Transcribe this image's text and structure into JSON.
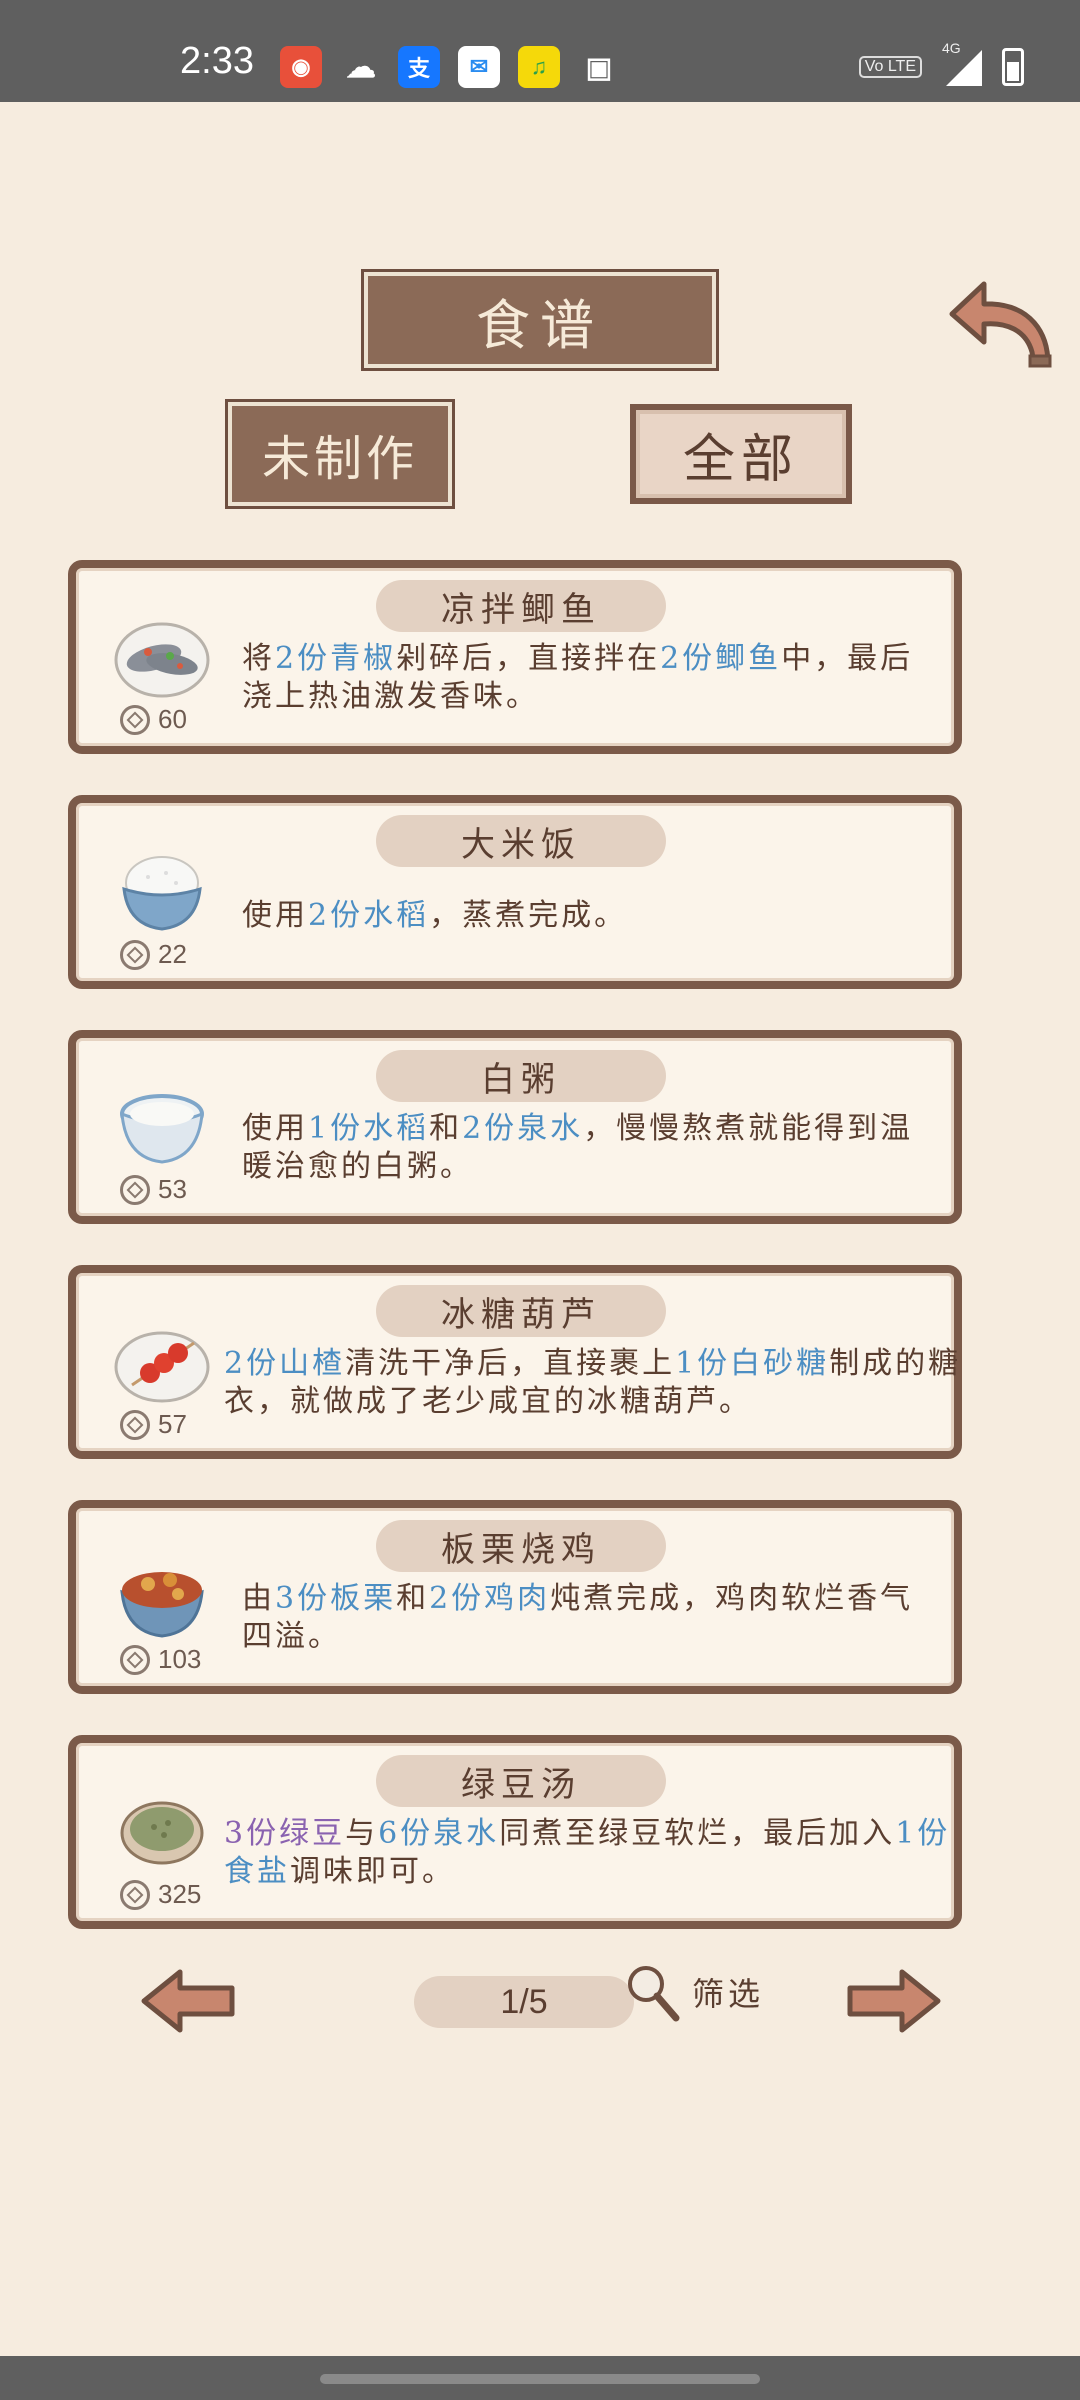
{
  "status_bar": {
    "time": "2:33",
    "notification_icons": [
      "game-app-icon",
      "wechat-icon",
      "alipay-icon",
      "messaging-app-icon",
      "music-app-icon",
      "gallery-icon"
    ],
    "volte_label": "Vo LTE",
    "network_label": "4G",
    "icons": [
      "signal-icon",
      "battery-icon"
    ]
  },
  "header": {
    "title": "食谱"
  },
  "tabs": [
    {
      "label": "未制作",
      "state": "inactive"
    },
    {
      "label": "全部",
      "state": "selected"
    }
  ],
  "recipes": [
    {
      "name": "凉拌鲫鱼",
      "cost": "60",
      "dish_icon": "fish-dish-icon",
      "desc": [
        {
          "t": "将"
        },
        {
          "t": "2份青椒",
          "hl": "blue"
        },
        {
          "t": "剁碎后，直接拌在"
        },
        {
          "t": "2份鲫鱼",
          "hl": "blue"
        },
        {
          "t": "中，最后浇上热油激发香味。"
        }
      ]
    },
    {
      "name": "大米饭",
      "cost": "22",
      "dish_icon": "rice-bowl-icon",
      "desc": [
        {
          "t": "使用"
        },
        {
          "t": "2份水稻",
          "hl": "blue"
        },
        {
          "t": "，蒸煮完成。"
        }
      ]
    },
    {
      "name": "白粥",
      "cost": "53",
      "dish_icon": "porridge-bowl-icon",
      "desc": [
        {
          "t": "使用"
        },
        {
          "t": "1份水稻",
          "hl": "blue"
        },
        {
          "t": "和"
        },
        {
          "t": "2份泉水",
          "hl": "blue"
        },
        {
          "t": "，慢慢熬煮就能得到温暖治愈的白粥。"
        }
      ]
    },
    {
      "name": "冰糖葫芦",
      "cost": "57",
      "dish_icon": "candied-haws-icon",
      "desc": [
        {
          "t": "2份山楂",
          "hl": "blue"
        },
        {
          "t": "清洗干净后，直接裹上"
        },
        {
          "t": "1份白砂糖",
          "hl": "blue"
        },
        {
          "t": "制成的糖衣，就做成了老少咸宜的冰糖葫芦。"
        }
      ]
    },
    {
      "name": "板栗烧鸡",
      "cost": "103",
      "dish_icon": "chestnut-chicken-icon",
      "desc": [
        {
          "t": "由"
        },
        {
          "t": "3份板栗",
          "hl": "blue"
        },
        {
          "t": "和"
        },
        {
          "t": "2份鸡肉",
          "hl": "blue"
        },
        {
          "t": "炖煮完成，鸡肉软烂香气四溢。"
        }
      ]
    },
    {
      "name": "绿豆汤",
      "cost": "325",
      "dish_icon": "mung-bean-soup-icon",
      "desc": [
        {
          "t": "3份绿豆",
          "hl": "purple"
        },
        {
          "t": "与"
        },
        {
          "t": "6份泉水",
          "hl": "blue"
        },
        {
          "t": "同煮至绿豆软烂，最后加入"
        },
        {
          "t": "1份食盐",
          "hl": "blue"
        },
        {
          "t": "调味即可。"
        }
      ]
    }
  ],
  "pagination": {
    "page": "1/5",
    "filter_label": "筛选"
  },
  "colors": {
    "wood": "#8b6a57",
    "border": "#7b5a49",
    "highlight_blue": "#4c8ec3",
    "highlight_purple": "#8a62b0",
    "background": "#f6ecdf"
  }
}
